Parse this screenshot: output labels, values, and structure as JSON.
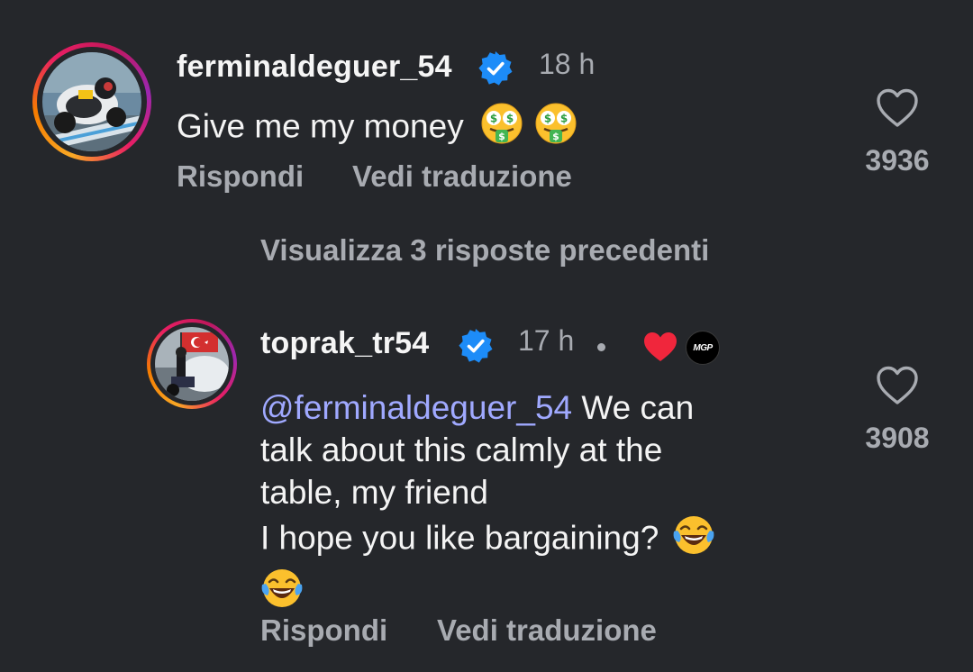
{
  "comment1": {
    "username": "ferminaldeguer_54",
    "time": "18 h",
    "text": "Give me my money",
    "emoji": [
      "money-mouth-face",
      "money-mouth-face"
    ],
    "reply_label": "Rispondi",
    "translate_label": "Vedi traduzione",
    "likes": "3936"
  },
  "view_replies": "Visualizza 3 risposte precedenti",
  "comment2": {
    "username": "toprak_tr54",
    "time": "17 h",
    "mention": "@ferminaldeguer_54",
    "line1_rest": " We can",
    "line2": "talk about this calmly at the",
    "line3": "table, my friend",
    "line4": "I hope you like bargaining?",
    "emoji": [
      "laughing-tears-face",
      "laughing-tears-face"
    ],
    "reply_label": "Rispondi",
    "translate_label": "Vedi traduzione",
    "likes": "3908",
    "badge_text": "MGP"
  },
  "colors": {
    "background": "#25272b",
    "verified": "#1d8cf8",
    "mention": "#a0a9ff",
    "secondary_text": "#a8abb1",
    "creator_heart": "#f0263c"
  }
}
